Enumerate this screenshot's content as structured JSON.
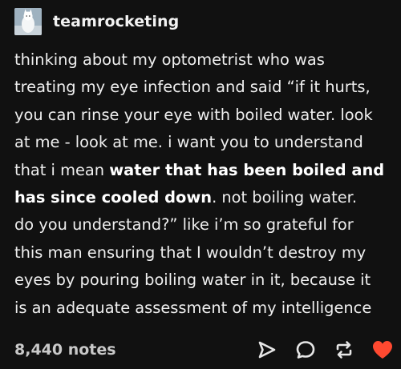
{
  "post": {
    "username": "teamrocketing",
    "lines": [
      {
        "parts": [
          {
            "text": "thinking about my optometrist who was",
            "bold": false
          }
        ]
      },
      {
        "parts": [
          {
            "text": "treating my eye infection and said “if it hurts,",
            "bold": false
          }
        ]
      },
      {
        "parts": [
          {
            "text": "you can rinse your eye with boiled water. look",
            "bold": false
          }
        ]
      },
      {
        "parts": [
          {
            "text": "at me - look at me. i want you to understand",
            "bold": false
          }
        ]
      },
      {
        "parts": [
          {
            "text": "that i mean ",
            "bold": false
          },
          {
            "text": "water that has been boiled and",
            "bold": true
          }
        ]
      },
      {
        "parts": [
          {
            "text": "has since cooled down",
            "bold": true
          },
          {
            "text": ". not boiling water.",
            "bold": false
          }
        ]
      },
      {
        "parts": [
          {
            "text": "do you understand?” like i’m so grateful for",
            "bold": false
          }
        ]
      },
      {
        "parts": [
          {
            "text": "this man ensuring that I wouldn’t destroy my",
            "bold": false
          }
        ]
      },
      {
        "parts": [
          {
            "text": "eyes by pouring boiling water in it, because it",
            "bold": false
          }
        ]
      },
      {
        "parts": [
          {
            "text": "is an adequate assessment of my intelligence",
            "bold": false
          }
        ]
      }
    ],
    "notes": "8,440 notes"
  },
  "icons": {
    "avatar": "avatar-image",
    "share": "share-icon",
    "reply": "reply-icon",
    "reblog": "reblog-icon",
    "like": "heart-icon"
  },
  "colors": {
    "background": "#111111",
    "text": "#efefef",
    "notes": "#c9c9c9",
    "icon": "#e6e6e6",
    "heart": "#ff4930"
  }
}
